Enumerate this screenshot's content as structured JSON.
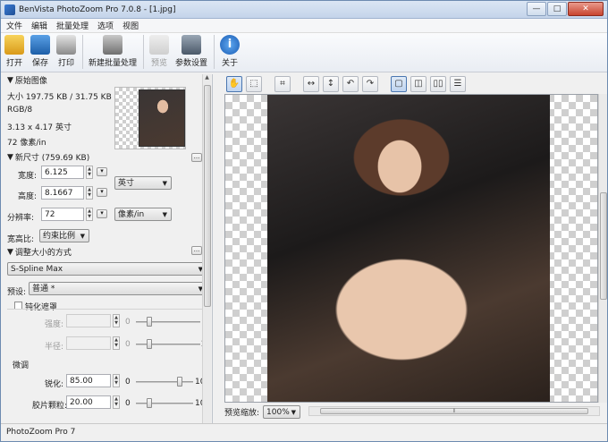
{
  "window": {
    "title": "BenVista PhotoZoom Pro 7.0.8 - [1.jpg]",
    "controls": [
      "—",
      "□",
      "✕"
    ]
  },
  "menu": [
    "文件",
    "编辑",
    "批量处理",
    "选项",
    "视图"
  ],
  "toolbar": [
    {
      "label": "打开",
      "icon": "open-folder-icon"
    },
    {
      "label": "保存",
      "icon": "save-icon"
    },
    {
      "label": "打印",
      "icon": "print-icon"
    },
    {
      "label": "新建批量处理",
      "icon": "batch-icon"
    },
    {
      "label": "预览",
      "icon": "preview-icon",
      "disabled": true
    },
    {
      "label": "参数设置",
      "icon": "settings-icon"
    },
    {
      "label": "关于",
      "icon": "info-icon"
    }
  ],
  "original": {
    "header": "原始图像",
    "size": "大小 197.75 KB / 31.75 KB",
    "mode": "RGB/8",
    "dimensions": "3.13 x 4.17 英寸",
    "resolution": "72 像素/in",
    "more": "..."
  },
  "new_size": {
    "header": "新尺寸 (759.69 KB)",
    "width_label": "宽度:",
    "width": "6.125",
    "height_label": "高度:",
    "height": "8.1667",
    "resolution_label": "分辨率:",
    "resolution": "72",
    "unit": "英寸",
    "res_unit": "像素/in",
    "aspect_label": "宽高比:",
    "aspect": "约束比例",
    "more": "..."
  },
  "resize_method": {
    "header": "调整大小的方式",
    "method": "S-Spline Max",
    "preset_label": "预设:",
    "preset": "普通 *",
    "more": "..."
  },
  "unsharp": {
    "label": "钝化遮罩",
    "strength_label": "强度:",
    "strength_min": "0",
    "strength_max": "5",
    "radius_label": "半径:",
    "radius_min": "0",
    "radius_max": "10"
  },
  "fine_tune": {
    "header": "微调",
    "sharpen_label": "锐化:",
    "sharpen": "85.00",
    "sharpen_min": "0",
    "sharpen_max": "100",
    "grain_label": "胶片颗粒:",
    "grain": "20.00",
    "grain_min": "0",
    "grain_max": "100"
  },
  "viewer": {
    "zoom_label": "预览缩放:",
    "zoom": "100%"
  },
  "status": "PhotoZoom Pro 7"
}
